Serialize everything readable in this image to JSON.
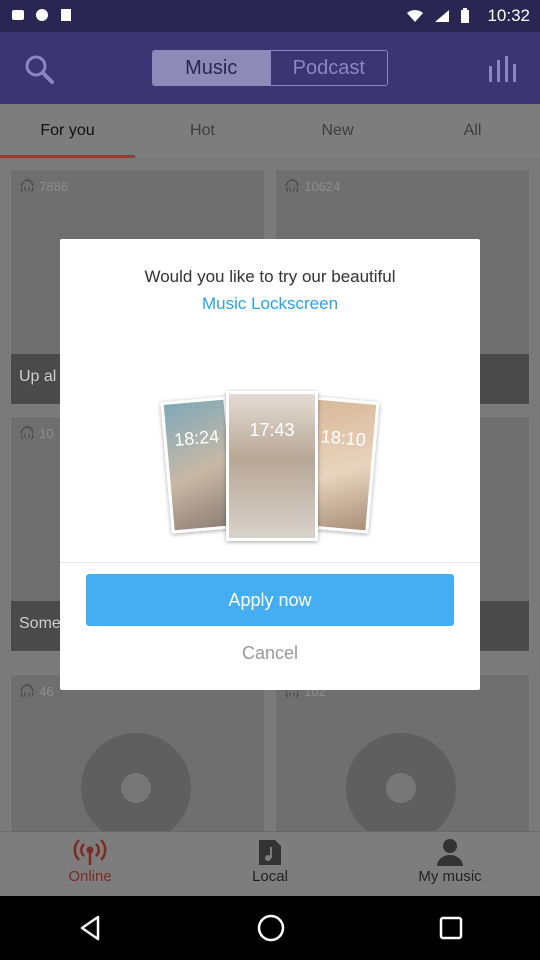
{
  "status_bar": {
    "time": "10:32"
  },
  "header": {
    "tab_music": "Music",
    "tab_podcast": "Podcast"
  },
  "tabs": [
    {
      "label": "For you"
    },
    {
      "label": "Hot"
    },
    {
      "label": "New"
    },
    {
      "label": "All"
    }
  ],
  "cards": [
    {
      "count": "7886",
      "caption": "Up al"
    },
    {
      "count": "10624",
      "caption": ""
    },
    {
      "count": "10",
      "caption": "Some"
    },
    {
      "count": "",
      "caption": ""
    },
    {
      "count": "46",
      "caption": ""
    },
    {
      "count": "102",
      "caption": ""
    }
  ],
  "dialog": {
    "line1": "Would you like to try our beautiful",
    "line2": "Music Lockscreen",
    "apply_label": "Apply now",
    "cancel_label": "Cancel",
    "preview_times": [
      "18:24",
      "17:43",
      "18:10"
    ]
  },
  "bottom_nav": [
    {
      "label": "Online",
      "icon": "broadcast-icon"
    },
    {
      "label": "Local",
      "icon": "music-file-icon"
    },
    {
      "label": "My music",
      "icon": "person-icon"
    }
  ],
  "colors": {
    "accent_blue": "#45aef2",
    "link_blue": "#2aa2ec",
    "header_purple": "#3b3572",
    "active_red": "#7a2c24"
  }
}
